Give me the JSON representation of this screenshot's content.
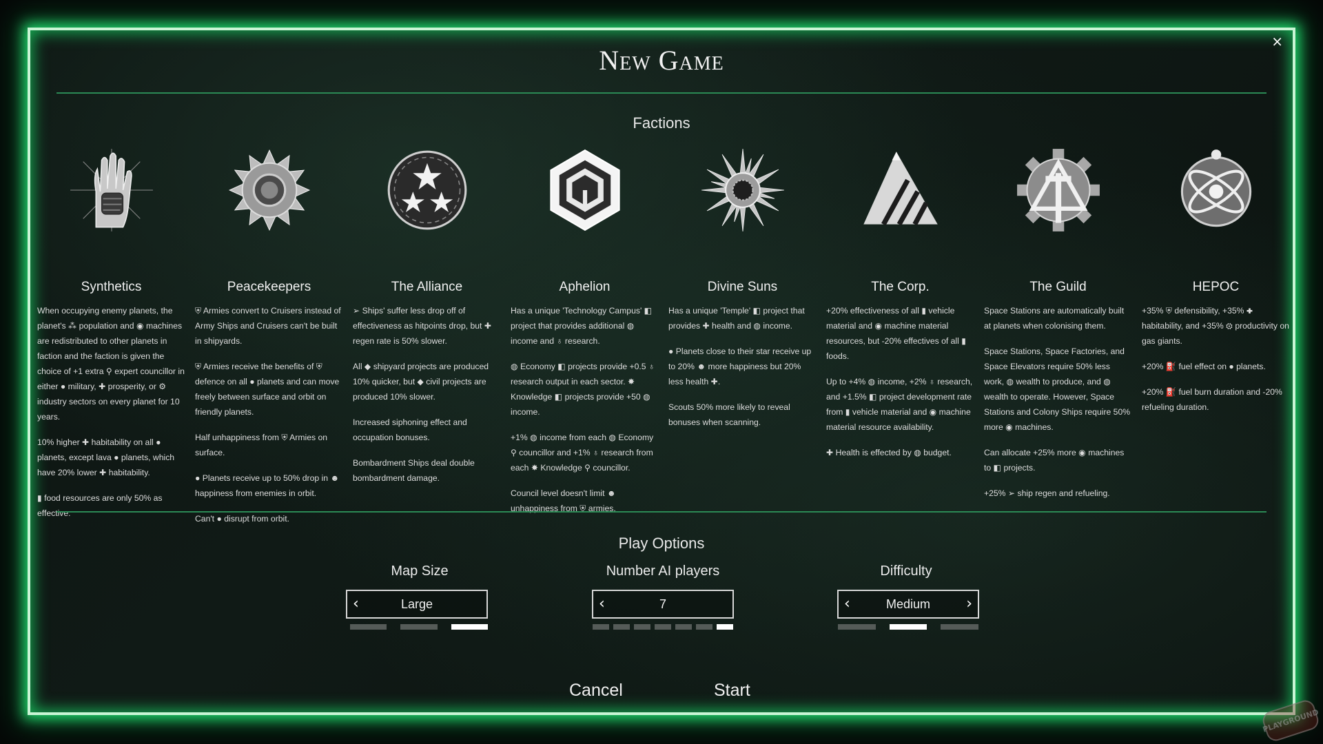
{
  "window": {
    "title": "New Game",
    "close_glyph": "×"
  },
  "factions_section": {
    "title": "Factions",
    "factions": [
      {
        "name": "Synthetics",
        "emblem": "raised-fist-hand-emblem",
        "paragraphs": [
          "When occupying enemy planets, the planet's ⁂ population and ◉ machines are redistributed to other planets in faction and the faction is given the choice of +1 extra ⚲ expert councillor in either ● military, ✚ prosperity, or ⚙ industry sectors on every planet for 10 years.",
          "10% higher ✚ habitability on all ● planets, except lava ● planets, which have 20% lower ✚ habitability.",
          "▮ food resources are only 50% as effective."
        ]
      },
      {
        "name": "Peacekeepers",
        "emblem": "sawblade-gear-emblem",
        "paragraphs": [
          "⛨ Armies convert to Cruisers instead of Army Ships and Cruisers can't be built in shipyards.",
          "⛨ Armies receive the benefits of ⛨ defence on all ● planets and can move freely between surface and orbit on friendly planets.",
          "Half unhappiness from ⛨ Armies on surface.",
          "● Planets receive up to 50% drop in ☻ happiness from enemies in orbit.",
          "Can't ● disrupt from orbit."
        ]
      },
      {
        "name": "The Alliance",
        "emblem": "three-stars-emblem",
        "paragraphs": [
          "➢ Ships' suffer less drop off of effectiveness as hitpoints drop, but ✚ regen rate is 50% slower.",
          "All ◆ shipyard projects are produced 10% quicker, but ◆ civil projects are produced 10% slower.",
          "Increased siphoning effect and occupation bonuses.",
          "Bombardment Ships deal double bombardment damage."
        ]
      },
      {
        "name": "Aphelion",
        "emblem": "hexagon-cube-emblem",
        "paragraphs": [
          "Has a unique 'Technology Campus' ◧ project that provides additional ◍ income and ♁ research.",
          "◍ Economy ◧ projects provide +0.5 ♁ research output in each sector. ✸ Knowledge ◧ projects provide +50 ◍ income.",
          "+1% ◍ income from each ◍ Economy ⚲ councillor and +1% ♁ research from each ✸ Knowledge ⚲ councillor.",
          "Council level doesn't limit ☻ unhappiness from ⛨ armies."
        ]
      },
      {
        "name": "Divine Suns",
        "emblem": "radiant-sun-emblem",
        "paragraphs": [
          "Has a unique 'Temple' ◧ project that provides ✚ health and ◍ income.",
          "● Planets close to their star receive up to 20% ☻ more happiness but 20% less health ✚.",
          "Scouts 50% more likely to reveal bonuses when scanning."
        ]
      },
      {
        "name": "The Corp.",
        "emblem": "striped-pyramid-emblem",
        "paragraphs": [
          "+20% effectiveness of all ▮ vehicle material and ◉ machine material resources, but -20% effectives of all ▮ foods.",
          "Up to +4% ◍ income, +2% ♁ research, and +1.5% ◧ project development rate from ▮ vehicle material and ◉ machine material resource availability.",
          "✚ Health is effected by ◍ budget."
        ]
      },
      {
        "name": "The Guild",
        "emblem": "cog-caliper-emblem",
        "paragraphs": [
          "Space Stations are automatically built at planets when colonising them.",
          "Space Stations, Space Factories, and Space Elevators require 50% less work, ◍ wealth to produce, and ◍ wealth to operate. However, Space Stations and Colony Ships require 50% more ◉ machines.",
          "Can allocate +25% more ◉ machines to ◧ projects.",
          "+25% ➢ ship regen and refueling."
        ]
      },
      {
        "name": "HEPOC",
        "emblem": "orbiting-atom-emblem",
        "paragraphs": [
          "+35% ⛨ defensibility, +35% ✚ habitability, and +35% ⚙ productivity on gas giants.",
          "+20% ⛽ fuel effect on ● planets.",
          "+20% ⛽ fuel burn duration and -20% refueling duration."
        ]
      }
    ]
  },
  "play_options": {
    "title": "Play Options",
    "map_size": {
      "label": "Map Size",
      "value": "Large",
      "left_arrow": "‹",
      "steps": 3,
      "selected": 3
    },
    "ai_players": {
      "label": "Number AI players",
      "value": "7",
      "left_arrow": "‹",
      "steps": 7,
      "selected": 7
    },
    "difficulty": {
      "label": "Difficulty",
      "value": "Medium",
      "left_arrow": "‹",
      "right_arrow": "›",
      "steps": 3,
      "selected": 2
    }
  },
  "buttons": {
    "cancel": "Cancel",
    "start": "Start"
  },
  "watermark": "PLAYGROUND",
  "colors": {
    "frame_glow": "#1fd26a",
    "frame_border": "#c9f5d5",
    "rule": "#2b8a55",
    "pip_on": "#ffffff",
    "pip_off": "#555b58"
  }
}
